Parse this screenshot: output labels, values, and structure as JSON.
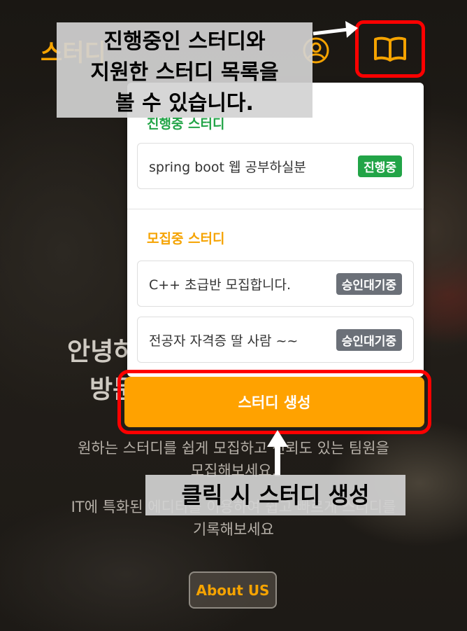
{
  "header": {
    "logo_text": "스터디",
    "user_icon": "user-circle-icon",
    "book_icon": "book-open-icon"
  },
  "panel": {
    "in_progress_title": "진행중 스터디",
    "in_progress_items": [
      {
        "name": "spring boot 웹 공부하실분",
        "badge": "진행중"
      }
    ],
    "recruiting_title": "모집중 스터디",
    "recruiting_items": [
      {
        "name": "C++ 초급반 모집합니다.",
        "badge": "승인대기중"
      },
      {
        "name": "전공자 자격증 딸 사람 ~~",
        "badge": "승인대기중"
      }
    ],
    "create_button": "스터디 생성"
  },
  "hero": {
    "heading_line1": "안녕하",
    "heading_line2": "방문",
    "text_line1": "원하는 스터디를 쉽게 모집하고 신뢰도 있는 팀원을",
    "text_line2": "모집해보세요.",
    "text_line3": "IT에 특화된 에디터를 이용하여 쉽고 빠르게 스터디를",
    "text_line4": "기록해보세요",
    "about_button": "About US"
  },
  "annotations": {
    "top_line1": "진행중인 스터디와",
    "top_line2": "지원한 스터디 목록을",
    "top_line3": "볼 수 있습니다.",
    "bottom": "클릭 시 스터디 생성"
  },
  "colors": {
    "accent": "#ffa200",
    "in_progress": "#22a447",
    "pending": "#6b7078",
    "highlight": "#ff0000"
  }
}
